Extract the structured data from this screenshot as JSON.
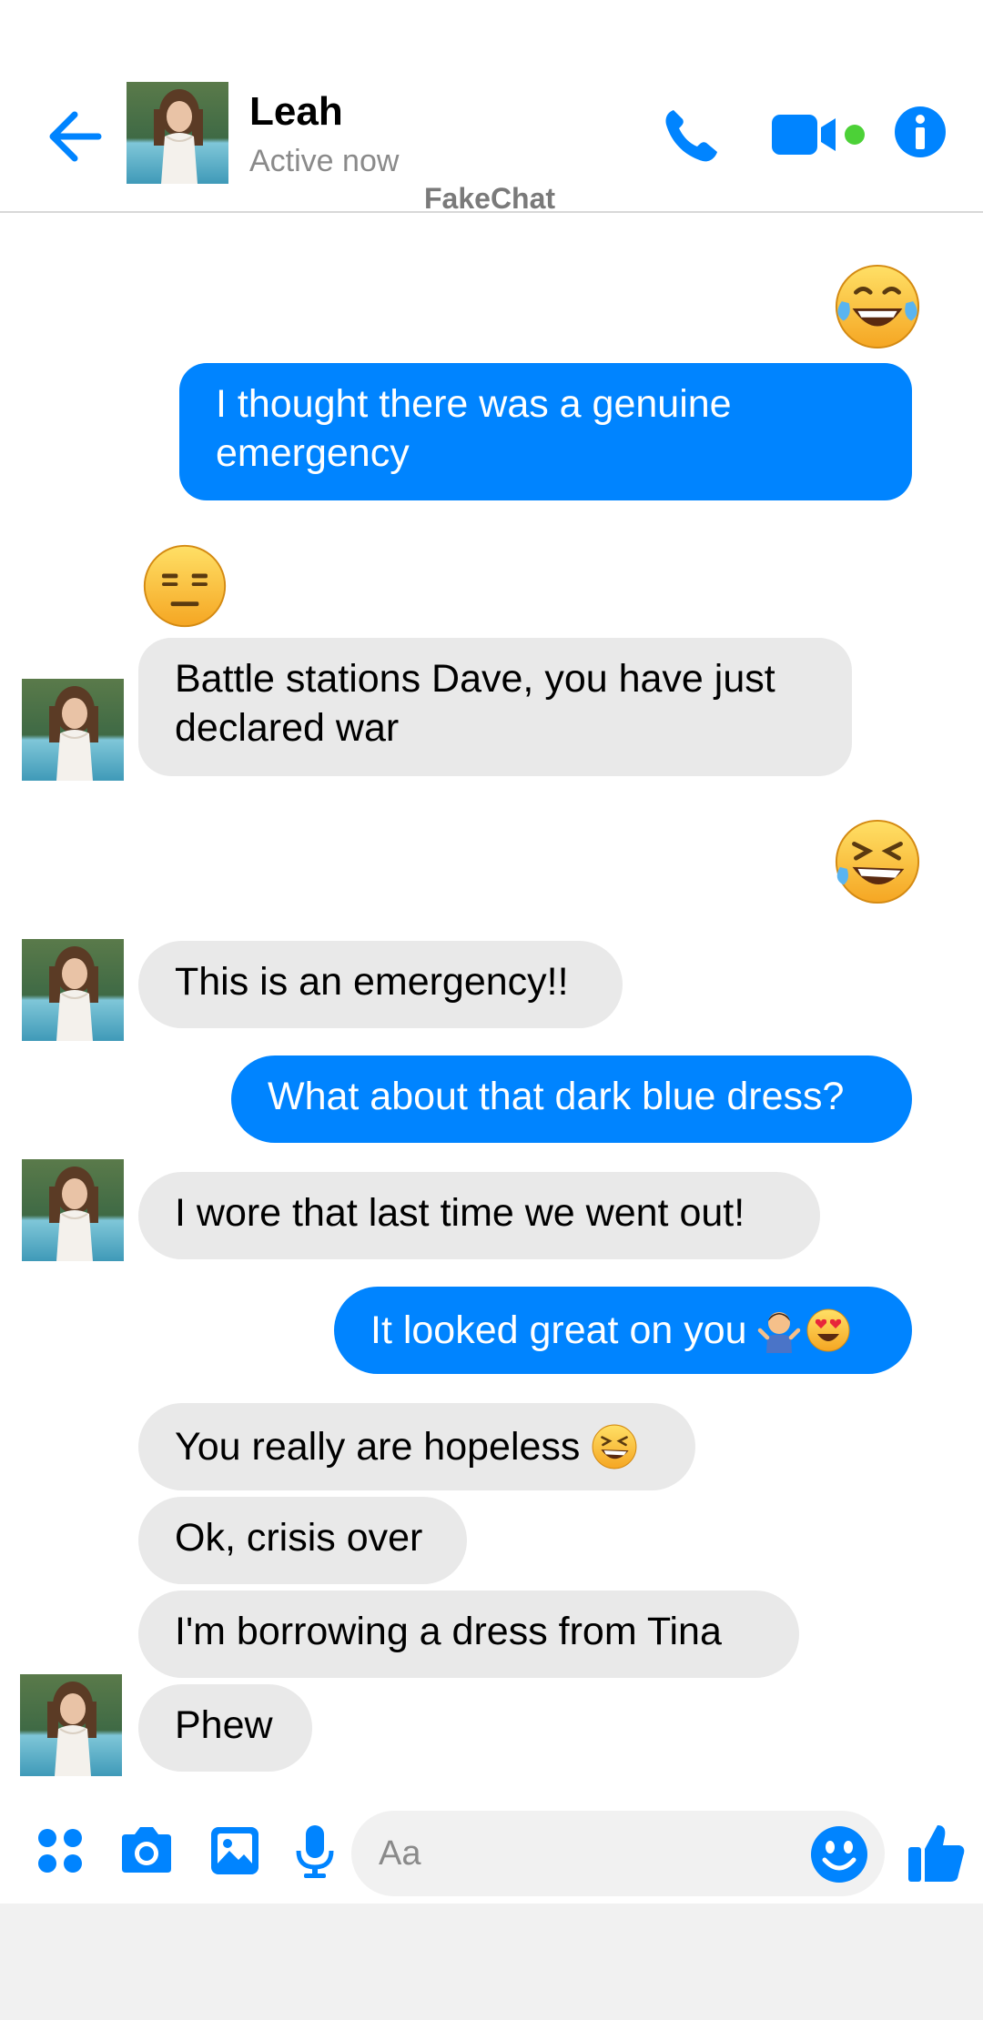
{
  "colors": {
    "accent": "#0084ff",
    "incoming_bubble": "#e9e9e9",
    "online": "#4cd137"
  },
  "header": {
    "back_icon": "back-arrow-icon",
    "contact_name": "Leah",
    "status": "Active now",
    "watermark": "FakeChat",
    "actions": [
      "phone-icon",
      "video-camera-icon",
      "info-icon"
    ]
  },
  "messages": [
    {
      "id": "m1",
      "direction": "outgoing",
      "reaction": "face-with-tears-of-joy",
      "lines": [
        "I thought there was a genuine",
        "emergency"
      ]
    },
    {
      "id": "m2",
      "direction": "incoming",
      "reaction": "expressionless-face",
      "lines": [
        "Battle stations Dave, you have just",
        "declared war"
      ]
    },
    {
      "id": "m3",
      "direction": "outgoing",
      "emoji_only": "rolling-on-the-floor-laughing"
    },
    {
      "id": "m4",
      "direction": "incoming",
      "text": "This is an emergency!!"
    },
    {
      "id": "m5",
      "direction": "outgoing",
      "text": "What about that dark blue dress?"
    },
    {
      "id": "m6",
      "direction": "incoming",
      "text": "I wore that last time we went out!"
    },
    {
      "id": "m7",
      "direction": "outgoing",
      "text": "It looked great on you",
      "emojis": [
        "man-shrugging",
        "smiling-face-with-heart-eyes"
      ]
    },
    {
      "id": "m8",
      "direction": "incoming",
      "text": "You really are hopeless",
      "emojis": [
        "rolling-on-the-floor-laughing"
      ]
    },
    {
      "id": "m9",
      "direction": "incoming",
      "text": "Ok, crisis over"
    },
    {
      "id": "m10",
      "direction": "incoming",
      "text": "I'm borrowing a dress from Tina"
    },
    {
      "id": "m11",
      "direction": "incoming",
      "text": "Phew"
    }
  ],
  "composer": {
    "icons": [
      "apps-icon",
      "camera-icon",
      "gallery-icon",
      "microphone-icon",
      "emoji-icon",
      "thumbs-up-icon"
    ],
    "placeholder": "Aa"
  }
}
